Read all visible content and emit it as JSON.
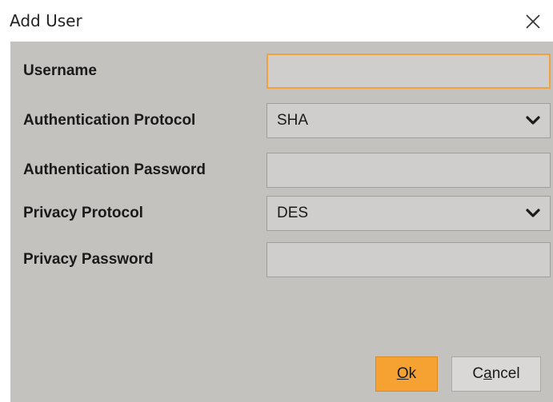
{
  "window": {
    "title": "Add User"
  },
  "form": {
    "username": {
      "label": "Username",
      "value": ""
    },
    "auth_protocol": {
      "label": "Authentication Protocol",
      "selected": "SHA"
    },
    "auth_password": {
      "label": "Authentication Password",
      "value": ""
    },
    "privacy_protocol": {
      "label": "Privacy Protocol",
      "selected": "DES"
    },
    "privacy_password": {
      "label": "Privacy Password",
      "value": ""
    }
  },
  "buttons": {
    "ok": {
      "mnemonic": "O",
      "rest": "k"
    },
    "cancel": {
      "before": "C",
      "mnemonic": "a",
      "rest": "ncel"
    }
  },
  "colors": {
    "panel_background": "#c4c2bf",
    "field_background": "#cfcecd",
    "focus_border": "#f0a23c",
    "primary_button": "#f5a233",
    "secondary_button": "#d9d8d6"
  },
  "icons": {
    "close": "close-icon",
    "dropdown": "chevron-down-icon"
  }
}
